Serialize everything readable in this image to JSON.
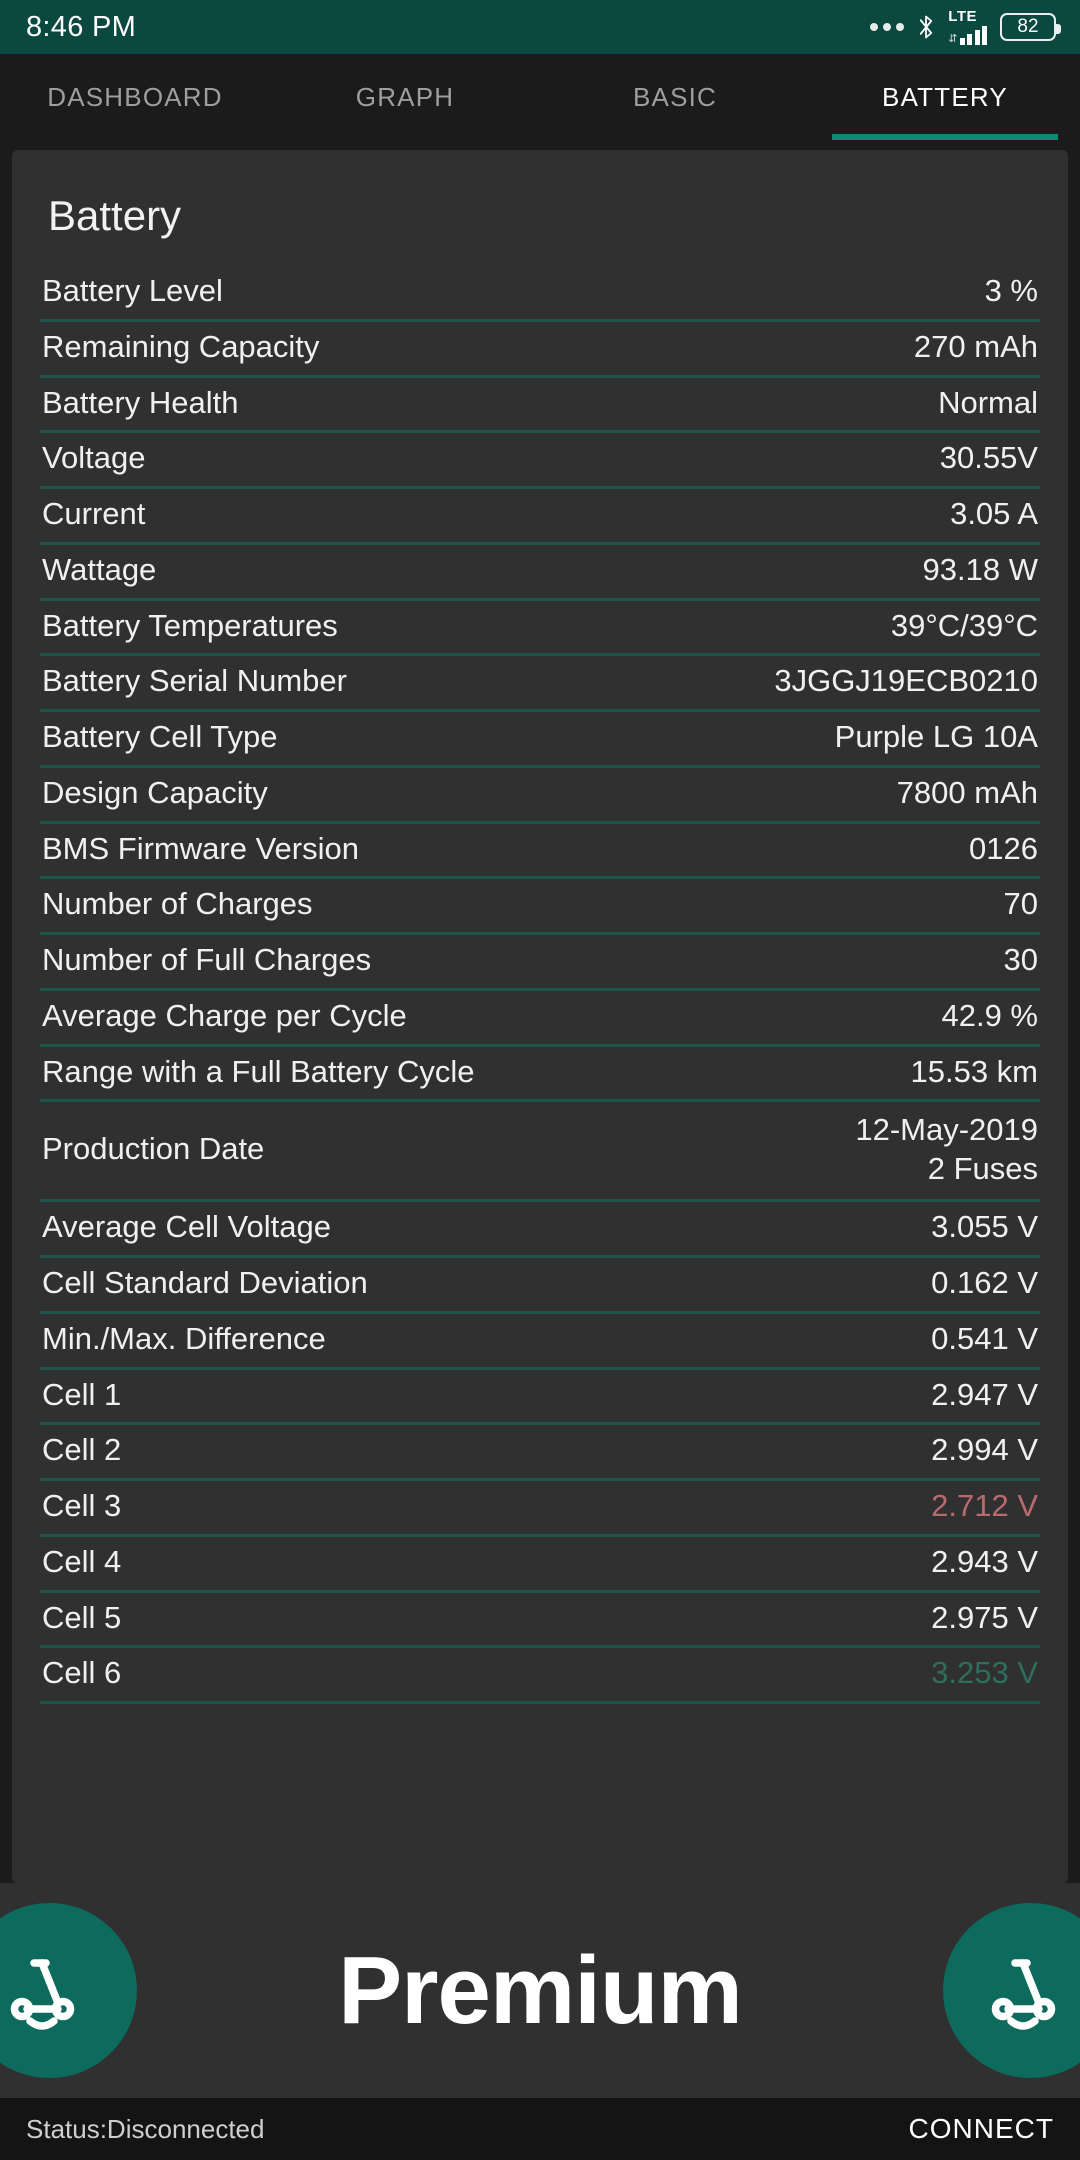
{
  "status_bar": {
    "clock": "8:46 PM",
    "battery_percent": "82",
    "network_type": "LTE",
    "icons": [
      "more-dots-icon",
      "bluetooth-icon",
      "signal-bars-icon",
      "battery-icon"
    ]
  },
  "tabs": [
    {
      "label": "DASHBOARD",
      "active": false
    },
    {
      "label": "GRAPH",
      "active": false
    },
    {
      "label": "BASIC",
      "active": false
    },
    {
      "label": "BATTERY",
      "active": true
    }
  ],
  "card": {
    "title": "Battery",
    "rows": [
      {
        "key": "Battery Level",
        "value": "3 %",
        "state": "normal"
      },
      {
        "key": "Remaining Capacity",
        "value": "270 mAh",
        "state": "normal"
      },
      {
        "key": "Battery Health",
        "value": "Normal",
        "state": "normal"
      },
      {
        "key": "Voltage",
        "value": "30.55V",
        "state": "normal"
      },
      {
        "key": "Current",
        "value": "3.05 A",
        "state": "normal"
      },
      {
        "key": "Wattage",
        "value": "93.18 W",
        "state": "normal"
      },
      {
        "key": "Battery Temperatures",
        "value": "39°C/39°C",
        "state": "normal"
      },
      {
        "key": "Battery Serial Number",
        "value": "3JGGJ19ECB0210",
        "state": "normal"
      },
      {
        "key": "Battery Cell Type",
        "value": "Purple LG 10A",
        "state": "normal"
      },
      {
        "key": "Design Capacity",
        "value": "7800 mAh",
        "state": "normal"
      },
      {
        "key": "BMS Firmware Version",
        "value": "0126",
        "state": "normal"
      },
      {
        "key": "Number of Charges",
        "value": "70",
        "state": "normal"
      },
      {
        "key": "Number of Full Charges",
        "value": "30",
        "state": "normal"
      },
      {
        "key": "Average Charge per Cycle",
        "value": "42.9 %",
        "state": "normal"
      },
      {
        "key": "Range with a Full Battery Cycle",
        "value": "15.53 km",
        "state": "normal"
      },
      {
        "key": "Production Date",
        "value": "12-May-2019\n2 Fuses",
        "state": "normal",
        "two_line": true
      },
      {
        "key": "Average Cell Voltage",
        "value": "3.055 V",
        "state": "normal"
      },
      {
        "key": "Cell Standard Deviation",
        "value": "0.162 V",
        "state": "normal"
      },
      {
        "key": "Min./Max. Difference",
        "value": "0.541 V",
        "state": "normal"
      },
      {
        "key": "Cell 1",
        "value": "2.947 V",
        "state": "normal"
      },
      {
        "key": "Cell 2",
        "value": "2.994 V",
        "state": "normal"
      },
      {
        "key": "Cell 3",
        "value": "2.712 V",
        "state": "low"
      },
      {
        "key": "Cell 4",
        "value": "2.943 V",
        "state": "normal"
      },
      {
        "key": "Cell 5",
        "value": "2.975 V",
        "state": "normal"
      },
      {
        "key": "Cell 6",
        "value": "3.253 V",
        "state": "high"
      }
    ]
  },
  "promo": {
    "label": "Premium",
    "icon_left": "scooter-icon",
    "icon_right": "scooter-icon"
  },
  "footer": {
    "status": "Status:Disconnected",
    "connect_label": "CONNECT"
  },
  "colors": {
    "status_bar_green": "#0b4840",
    "accent_teal": "#0d6b5e",
    "tab_indicator": "#0d8a74",
    "separator": "#1e5449",
    "card_bg": "#303030",
    "app_bg": "#1b1b1b",
    "value_low": "#b86a6e",
    "value_high": "#2f6d5c"
  }
}
